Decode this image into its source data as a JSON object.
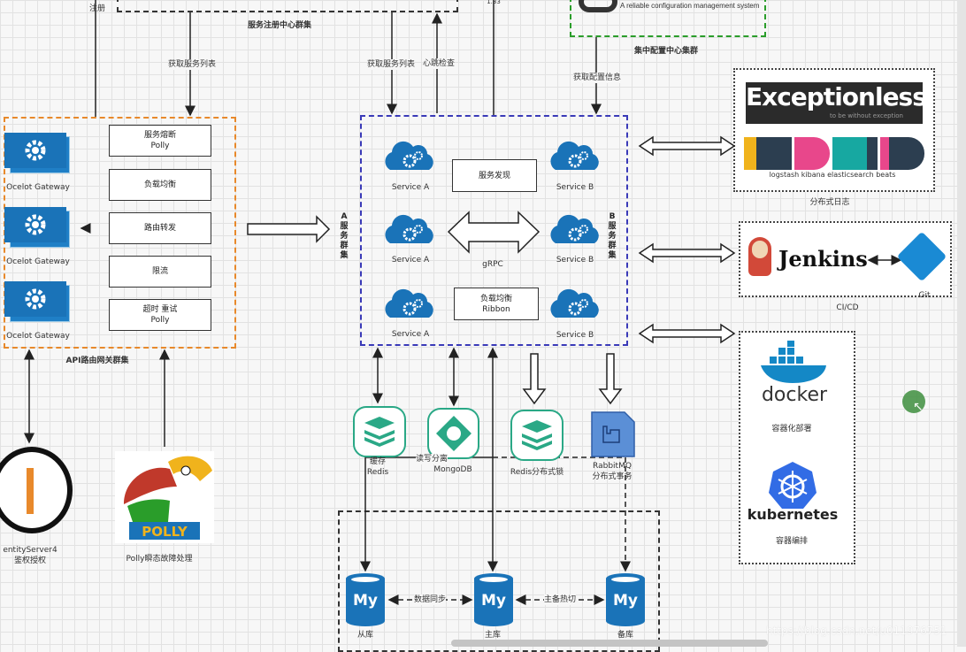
{
  "registry": {
    "title": "服务注册中心群集",
    "register_label": "注册",
    "get_list_left": "获取服务列表",
    "get_list_right": "获取服务列表",
    "heartbeat": "心跳检查",
    "top_text": "1.33"
  },
  "config": {
    "title": "集中配置中心集群",
    "tagline": "A reliable configuration management system",
    "get_config": "获取配置信息"
  },
  "gateway": {
    "title": "API路由网关群集",
    "instances": [
      "Ocelot Gateway",
      "Ocelot Gateway",
      "Ocelot Gateway"
    ],
    "features": [
      {
        "line1": "服务熔断",
        "line2": "Polly"
      },
      {
        "line1": "负载均衡",
        "line2": ""
      },
      {
        "line1": "路由转发",
        "line2": ""
      },
      {
        "line1": "限流",
        "line2": ""
      },
      {
        "line1": "超时 重试",
        "line2": "Polly"
      }
    ]
  },
  "services": {
    "a_cluster": "A服务群集",
    "b_cluster": "B服务群集",
    "service_a": "Service A",
    "service_b": "Service B",
    "discovery": "服务发现",
    "grpc": "gRPC",
    "lb_line1": "负载均衡",
    "lb_line2": "Ribbon"
  },
  "logging": {
    "title": "分布式日志",
    "exceptionless": "Exceptionless",
    "exceptionless_tag": "to be without exception",
    "elk_components": "logstash  kibana  elasticsearch  beats"
  },
  "cicd": {
    "title": "CI/CD",
    "jenkins": "Jenkins",
    "git": "Git"
  },
  "containers": {
    "docker": "docker",
    "docker_label": "容器化部署",
    "kubernetes": "kubernetes",
    "k8s_label": "容器编排"
  },
  "middleware": {
    "cache_line1": "缓存",
    "cache_line2": "Redis",
    "rw_split": "读写分离",
    "mongodb": "MongoDB",
    "redis_lock": "Redis分布式锁",
    "rabbit_line1": "RabbitMQ",
    "rabbit_line2": "分布式事务"
  },
  "database": {
    "slave": "从库",
    "master": "主库",
    "backup": "备库",
    "sync": "数据同步",
    "failover": "主备热切",
    "logo_text": "My"
  },
  "identity": {
    "line1": "entityServer4",
    "line2": "鉴权授权"
  },
  "polly": {
    "label": "Polly瞬态故障处理",
    "logo_text": "POLLY"
  },
  "watermark": "https://blog.csdn.net/u011976751",
  "colors": {
    "gateway_frame": "#e8892b",
    "services_frame": "#3a3ab8",
    "config_frame": "#2a9d2a",
    "icon_blue": "#1a73b8",
    "redis_green": "#2aa886"
  }
}
